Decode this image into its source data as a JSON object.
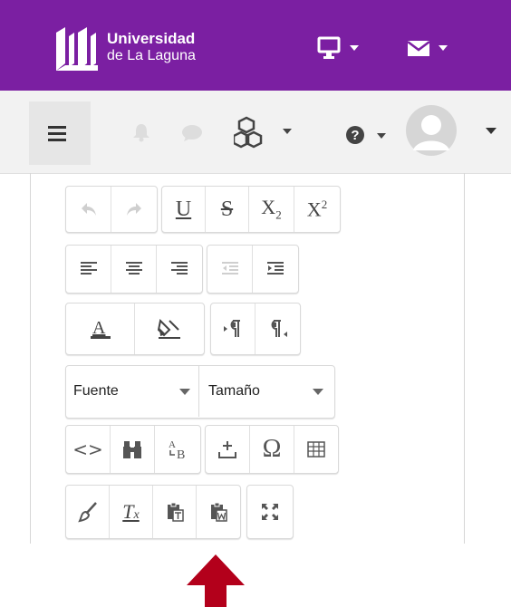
{
  "header": {
    "brand_line1": "Universidad",
    "brand_line2": "de La Laguna",
    "color": "#7b1fa2",
    "icons": [
      "ull-logo-icon",
      "monitor-icon",
      "mail-icon"
    ]
  },
  "navbar": {
    "icons": [
      "menu-icon",
      "bell-icon",
      "chat-icon",
      "cubes-icon",
      "help-icon",
      "avatar"
    ]
  },
  "toolbar": {
    "font_select": {
      "label": "Fuente"
    },
    "size_select": {
      "label": "Tamaño"
    },
    "buttons": {
      "subscript_label": "X",
      "subscript_sub": "2",
      "superscript_label": "X",
      "superscript_sup": "2",
      "underline_label": "U",
      "strike_label": "S",
      "clear_format_label": "T",
      "clear_format_sub": "x",
      "ab_label_a": "A",
      "ab_label_b": "B"
    }
  },
  "arrow_color": "#b3001b"
}
